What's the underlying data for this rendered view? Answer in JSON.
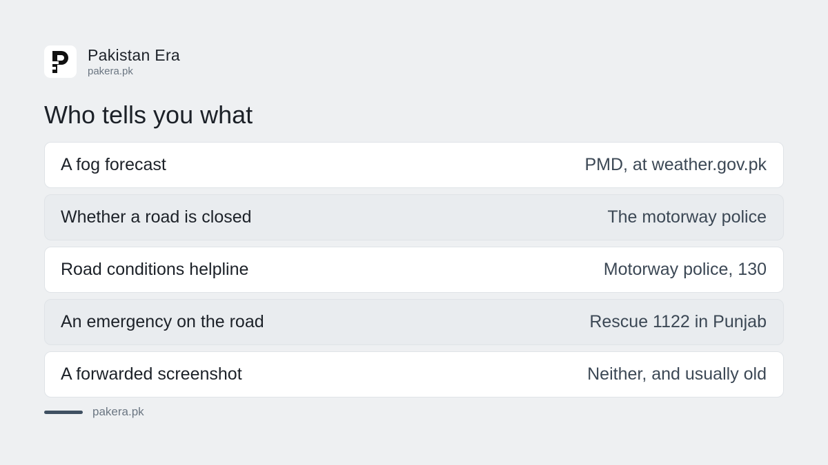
{
  "brand": {
    "name": "Pakistan Era",
    "url": "pakera.pk",
    "logo_icon": "pakistan-era-logo"
  },
  "title": "Who tells you what",
  "rows": [
    {
      "label": "A fog forecast",
      "value": "PMD, at weather.gov.pk"
    },
    {
      "label": "Whether a road is closed",
      "value": "The motorway police"
    },
    {
      "label": "Road conditions helpline",
      "value": "Motorway police, 130"
    },
    {
      "label": "An emergency on the road",
      "value": "Rescue 1122 in Punjab"
    },
    {
      "label": "A forwarded screenshot",
      "value": "Neither, and usually old"
    }
  ],
  "footer": {
    "url": "pakera.pk"
  },
  "colors": {
    "background": "#eef0f2",
    "card_light": "#ffffff",
    "card_alt": "#e9ecef",
    "accent_bar": "#3f5062",
    "text_primary": "#1c2128",
    "text_secondary": "#3c4855",
    "text_muted": "#6b7682"
  }
}
